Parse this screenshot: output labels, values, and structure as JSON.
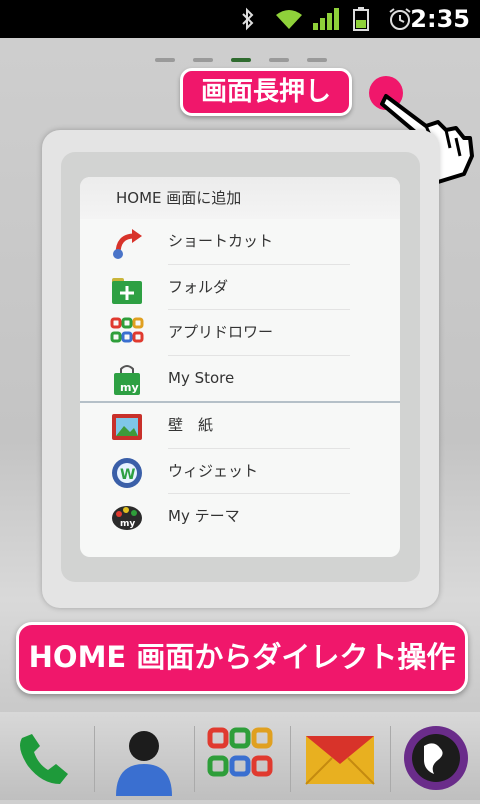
{
  "status_bar": {
    "time": "2:35",
    "icons": [
      "bluetooth-icon",
      "wifi-icon",
      "signal-icon",
      "battery-icon",
      "alarm-icon"
    ]
  },
  "page_indicator": {
    "count": 5,
    "active_index": 2
  },
  "callouts": {
    "top": "画面長押し",
    "bottom": "HOME 画面からダイレクト操作"
  },
  "menu": {
    "title": "HOME 画面に追加",
    "items": [
      {
        "label": "ショートカット",
        "icon": "shortcut-arrow-icon"
      },
      {
        "label": "フォルダ",
        "icon": "folder-add-icon"
      },
      {
        "label": "アプリドロワー",
        "icon": "app-drawer-icon"
      },
      {
        "label": "My Store",
        "icon": "store-bag-icon"
      },
      {
        "label": "壁　紙",
        "icon": "wallpaper-icon"
      },
      {
        "label": "ウィジェット",
        "icon": "widget-gear-icon"
      },
      {
        "label": "My テーマ",
        "icon": "theme-palette-icon"
      }
    ]
  },
  "dock": {
    "items": [
      "phone-icon",
      "contacts-icon",
      "app-drawer-icon",
      "mail-icon",
      "browser-globe-icon"
    ]
  },
  "colors": {
    "accent": "#f0176b"
  }
}
